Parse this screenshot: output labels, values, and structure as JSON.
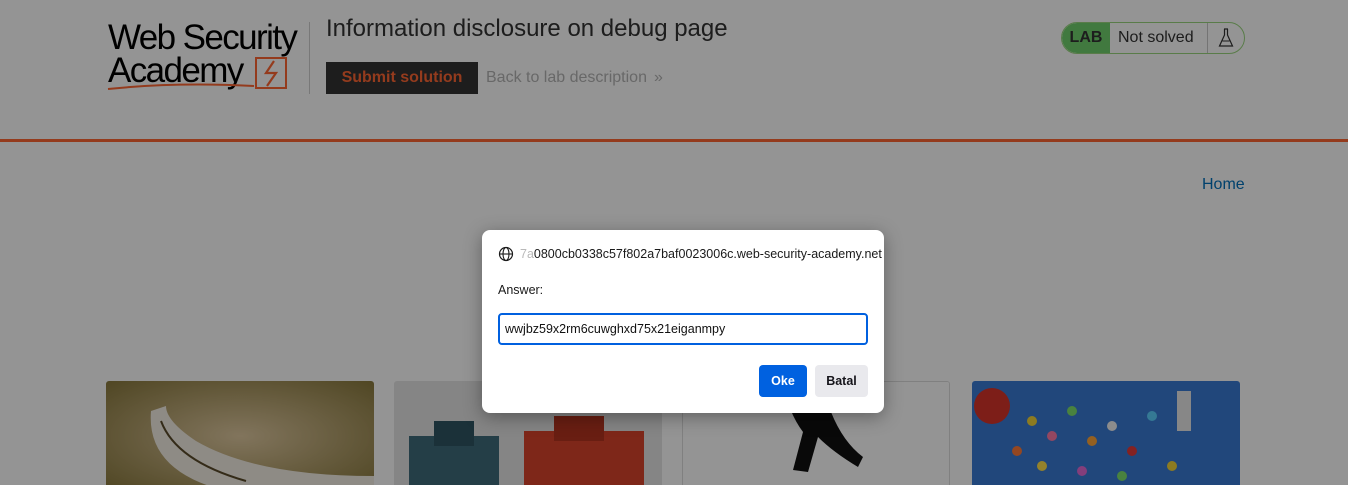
{
  "header": {
    "logo_line1": "Web Security",
    "logo_line2": "Academy",
    "lab_title": "Information disclosure on debug page",
    "submit_label": "Submit solution",
    "back_label": "Back to lab description",
    "back_chevron": "»",
    "status_badge": "LAB",
    "status_text": "Not solved",
    "colors": {
      "accent": "#ff6633",
      "badge": "#70d16d",
      "link": "#0071bc"
    }
  },
  "nav": {
    "home_label": "Home"
  },
  "dialog": {
    "origin_faded": "7a",
    "origin_text": "0800cb0338c57f802a7baf0023006c.web-security-academy.net",
    "prompt_label": "Answer:",
    "answer_value": "wwjbz59x2rm6cuwghxd75x21eiganmpy",
    "ok_label": "Oke",
    "cancel_label": "Batal",
    "icons": {
      "origin": "globe-icon"
    }
  }
}
